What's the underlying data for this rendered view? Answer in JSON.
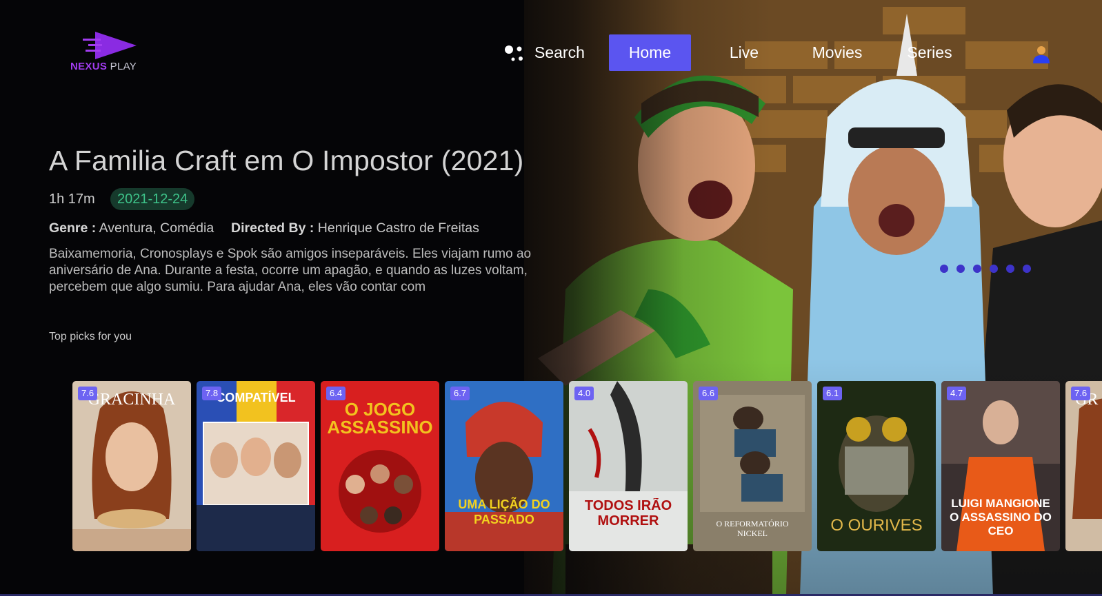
{
  "app": {
    "logo_primary": "NEXUS",
    "logo_secondary": "PLAY",
    "accent_color": "#5b55f0",
    "logo_color": "#a23cf0"
  },
  "nav": {
    "search_label": "Search",
    "search_icon": "google-assistant-dots-icon",
    "items": [
      {
        "label": "Home",
        "active": true
      },
      {
        "label": "Live",
        "active": false
      },
      {
        "label": "Movies",
        "active": false
      },
      {
        "label": "Series",
        "active": false
      }
    ],
    "profile_icon": "user-icon"
  },
  "featured": {
    "title": "A Familia Craft em O Impostor (2021)",
    "duration": "1h 17m",
    "release_date": "2021-12-24",
    "genre_label": "Genre :",
    "genre": "Aventura, Comédia",
    "director_label": "Directed By :",
    "director": "Henrique Castro de Freitas",
    "synopsis": "Baixamemoria, Cronosplays e Spok são amigos inseparáveis. Eles viajam rumo ao aniversário de Ana. Durante a festa, ocorre um apagão, e quando as luzes voltam, percebem que algo sumiu. Para ajudar Ana, eles vão contar com",
    "carousel_total": 6,
    "carousel_active_index": 0
  },
  "row": {
    "title": "Top picks for you",
    "items": [
      {
        "rating": "7.6",
        "poster_text": "GRACINHA"
      },
      {
        "rating": "7.8",
        "poster_text": "COMPATÍVEL"
      },
      {
        "rating": "6.4",
        "poster_text": "O JOGO ASSASSINO"
      },
      {
        "rating": "6.7",
        "poster_text": "UMA LIÇÃO DO PASSADO"
      },
      {
        "rating": "4.0",
        "poster_text": "TODOS IRÃO MORRER"
      },
      {
        "rating": "6.6",
        "poster_text": "O REFORMATÓRIO NICKEL"
      },
      {
        "rating": "6.1",
        "poster_text": "O OURIVES"
      },
      {
        "rating": "4.7",
        "poster_text": "LUIGI MANGIONE O ASSASSINO DO CEO"
      },
      {
        "rating": "7.6",
        "poster_text": "GR"
      }
    ]
  }
}
